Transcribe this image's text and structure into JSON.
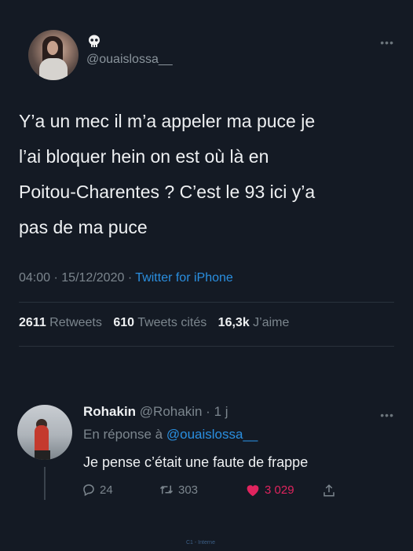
{
  "main_tweet": {
    "handle": "@ouaislossa__",
    "name_icon": "skull-icon",
    "more_icon": "more-horizontal-icon",
    "text_lines": [
      "Y’a un mec il m’a appeler ma puce je",
      "l’ai bloquer hein on est où là en",
      "Poitou-Charentes ? C’est le 93 ici y’a",
      "pas de ma puce"
    ],
    "time": "04:00",
    "separator": "·",
    "date": "15/12/2020",
    "source": "Twitter for iPhone",
    "stats": {
      "retweets_count": "2611",
      "retweets_label": "Retweets",
      "quotes_count": "610",
      "quotes_label": "Tweets cités",
      "likes_count": "16,3k",
      "likes_label": "J’aime"
    }
  },
  "reply": {
    "name": "Rohakin",
    "handle": "@Rohakin",
    "separator": "·",
    "age": "1 j",
    "replying_prefix": "En réponse à",
    "replying_to": "@ouaislossa__",
    "text": "Je pense c’était une faute de frappe",
    "actions": {
      "reply_count": "24",
      "retweet_count": "303",
      "like_count": "3 029"
    }
  },
  "watermark": "C1 - Interne",
  "colors": {
    "background": "#141a24",
    "link": "#2a8fe0",
    "like": "#e0245e",
    "muted": "#7c868e"
  }
}
